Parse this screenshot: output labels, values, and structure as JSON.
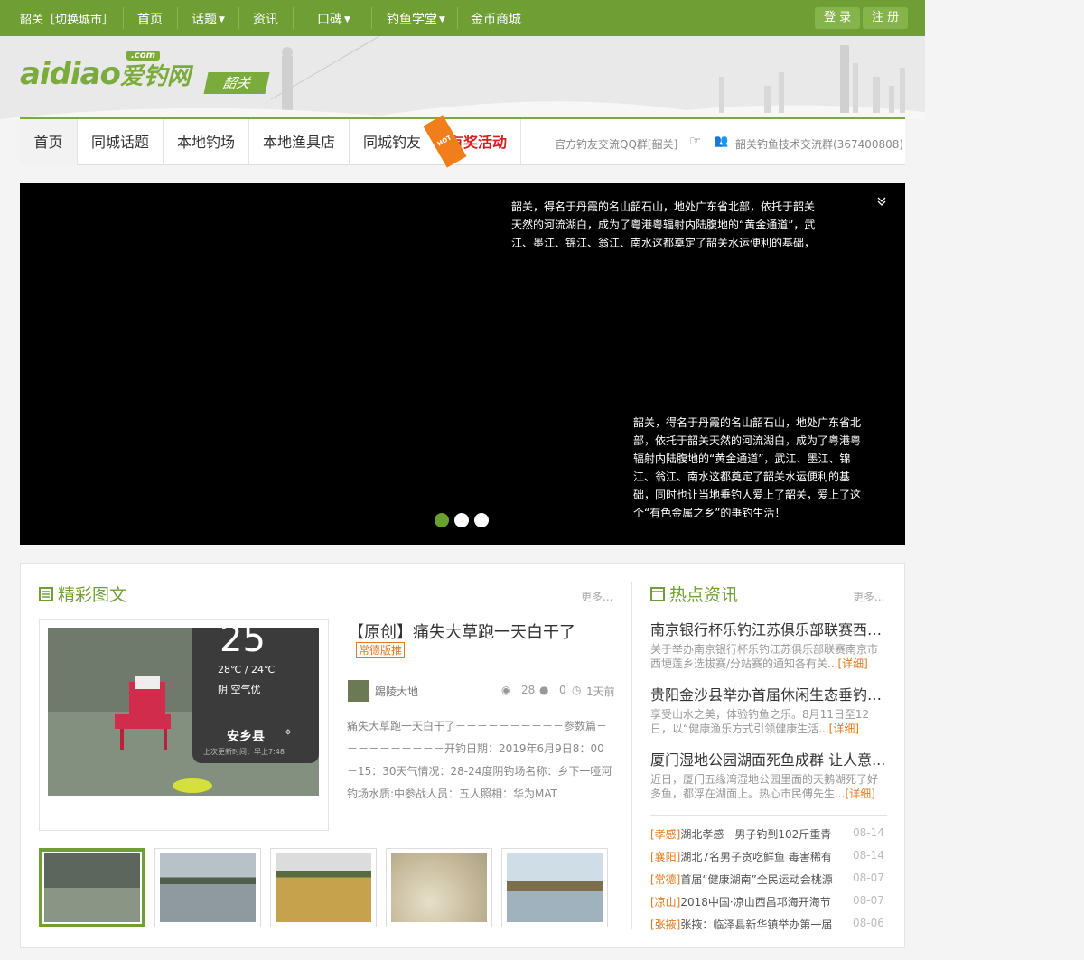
{
  "topbar": {
    "city": "韶关［切换城市］",
    "nav": [
      "首页",
      "话题",
      "资讯",
      "口碑",
      "钓鱼学堂",
      "金币商城"
    ],
    "login": "登 录",
    "register": "注 册"
  },
  "logo": {
    "word": "aidiao",
    "cn": "爱钓网",
    "com": ".com",
    "city": "韶关"
  },
  "subnav": {
    "tabs": [
      "首页",
      "同城话题",
      "本地钓场",
      "本地渔具店",
      "同城钓友",
      "有奖活动"
    ],
    "hot_badge": "HOT",
    "qq_official": "官方钓友交流QQ群[韶关]",
    "qq_group": "韶关钓鱼技术交流群(367400808)"
  },
  "banner": {
    "text1": "韶关，得名于丹霞的名山韶石山，地处广东省北部，依托于韶关天然的河流湖白，成为了粤港粤辐射内陆腹地的“黄金通道”，武江、墨江、锦江、翁江、南水这都奠定了韶关水运便利的基础，",
    "text2": "韶关，得名于丹霞的名山韶石山，地处广东省北部，依托于韶关天然的河流湖白，成为了粤港粤辐射内陆腹地的“黄金通道”，武江、墨江、锦江、翁江、南水这都奠定了韶关水运便利的基础，同时也让当地垂钓人爱上了韶关，爱上了这个“有色金属之乡”的垂钓生活！",
    "collapse_icon": "double-chevron-down"
  },
  "featured": {
    "section_title": "精彩图文",
    "more": "更多...",
    "photo_caption": {
      "temp": "25",
      "range": "28℃ / 24℃",
      "weather": "阴  空气优",
      "county": "安乡县",
      "updated": "上次更新时间：早上7:48"
    },
    "article_title": "【原创】痛失大草跑一天白干了",
    "tag": "常德版推",
    "author": "踢陵大地",
    "views": "28",
    "comments": "0",
    "time": "1天前",
    "excerpt": "痛失大草跑一天白干了－－－－－－－－－－参数篇－－－－－－－－－－开钓日期：2019年6月9日8：00－15：30天气情况：28-24度阴钓场名称：乡下一哑河钓场水质:中参战人员：五人照相：华为MAT"
  },
  "news": {
    "section_title": "热点资讯",
    "more": "更多...",
    "top": [
      {
        "title": "南京银行杯乐钓江苏俱乐部联赛西埂...",
        "desc": "关于举办南京银行杯乐钓江苏俱乐部联赛南京市西埂莲乡选拔赛/分站赛的通知各有关",
        "detail": "...[详细]"
      },
      {
        "title": "贵阳金沙县举办首届休闲生态垂钓大...",
        "desc": "享受山水之美，体验钓鱼之乐。8月11日至12日，以“健康渔乐方式引领健康生活",
        "detail": "...[详细]"
      },
      {
        "title": "厦门湿地公园湖面死鱼成群 让人意...",
        "desc": "近日，厦门五缘湾湿地公园里面的天鹅湖死了好多鱼，都浮在湖面上。热心市民傅先生",
        "detail": "...[详细]"
      }
    ],
    "list": [
      {
        "region": "[孝感]",
        "title": "湖北孝感一男子钓到102斤重青",
        "date": "08-14"
      },
      {
        "region": "[襄阳]",
        "title": "湖北7名男子贪吃鲜鱼 毒害稀有",
        "date": "08-14"
      },
      {
        "region": "[常德]",
        "title": "首届“健康湖南”全民运动会桃源",
        "date": "08-07"
      },
      {
        "region": "[凉山]",
        "title": "2018中国·凉山西昌邛海开海节",
        "date": "08-07"
      },
      {
        "region": "[张掖]",
        "title": "张掖：临泽县新华镇举办第一届",
        "date": "08-06"
      }
    ]
  },
  "colors": {
    "brand_green": "#6f9f34",
    "accent_orange": "#e07a1f",
    "hot_red": "#d42020"
  }
}
